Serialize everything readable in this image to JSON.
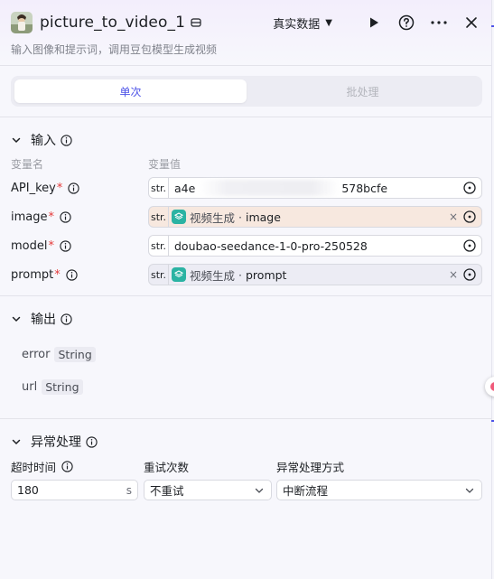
{
  "header": {
    "title": "picture_to_video_1",
    "subtitle": "输入图像和提示词，调用豆包模型生成视频",
    "data_mode": "真实数据",
    "icons": [
      "image-thumbnail",
      "node-db-icon",
      "play-icon",
      "help-icon",
      "more-icon",
      "close-icon"
    ]
  },
  "tabs": [
    {
      "label": "单次",
      "active": true
    },
    {
      "label": "批处理",
      "active": false
    }
  ],
  "inputs": {
    "section_title": "输入",
    "col_name": "变量名",
    "col_value": "变量值",
    "params": [
      {
        "name": "API_key",
        "required": "*",
        "type": "str.",
        "value_start": "a4e",
        "value_end": "578bcfe"
      },
      {
        "name": "image",
        "required": "*",
        "type": "str.",
        "ref_node": "视频生成",
        "ref_sep": "·",
        "ref_var": "image"
      },
      {
        "name": "model",
        "required": "*",
        "type": "str.",
        "value": "doubao-seedance-1-0-pro-250528"
      },
      {
        "name": "prompt",
        "required": "*",
        "type": "str.",
        "ref_node": "视频生成",
        "ref_sep": "·",
        "ref_var": "prompt"
      }
    ],
    "clear_glyph": "×"
  },
  "outputs": {
    "section_title": "输出",
    "items": [
      {
        "name": "error",
        "type": "String"
      },
      {
        "name": "url",
        "type": "String"
      }
    ]
  },
  "exception": {
    "section_title": "异常处理",
    "timeout_label": "超时时间",
    "timeout_value": "180",
    "timeout_unit": "s",
    "retry_label": "重试次数",
    "retry_value": "不重试",
    "handling_label": "异常处理方式",
    "handling_value": "中断流程"
  },
  "colors": {
    "accent": "#4d53e8",
    "required": "#e53a3a",
    "node_icon": "#2bb3a3",
    "image_ref_bg": "#f7e8df",
    "prompt_ref_bg": "#ececf4"
  }
}
